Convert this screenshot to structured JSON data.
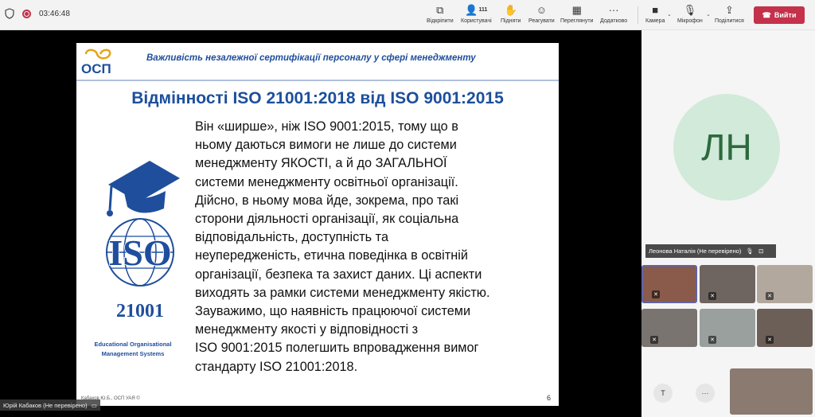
{
  "topbar": {
    "timer": "03:46:48",
    "participants_count": "111",
    "buttons": {
      "open": "Відкріпити",
      "users": "Користувачі",
      "raise": "Підняти",
      "react": "Реагувати",
      "view": "Переглянути",
      "more": "Додатково",
      "camera": "Камера",
      "mic": "Мікрофон",
      "share": "Поділитися"
    },
    "leave_label": "Вийти"
  },
  "slide": {
    "logo_text": "ОСП",
    "header": "Важливість незалежної сертифікації персоналу у сфері менеджменту",
    "title": "Відмінності ISO 21001:2018 від ISO 9001:2015",
    "body": "Він «ширше», ніж ISO 9001:2015, тому що в\nньому даються вимоги не лише до системи\nменеджменту ЯКОСТІ, а й до ЗАГАЛЬНОЇ\nсистеми менеджменту освітньої організації.\nДійсно, в ньому мова йде, зокрема, про такі\nсторони діяльності організації, як соціальна\nвідповідальність, доступність та\nнеупередженість, етична поведінка в освітній\nорганізації, безпека та захист даних. Ці аспекти\nвиходять за рамки системи менеджменту якістю.\nЗауважимо, що наявність працюючої системи\nменеджменту якості у відповідності з\nISO 9001:2015 полегшить впровадження вимог\nстандарту ISO 21001:2018.",
    "iso_text": "ISO",
    "iso_number": "21001",
    "iso_caption": "Educational Organisational Management Systems",
    "footer": "Кабаков Ю.Б., ОСП УАЯ ©",
    "page": "6"
  },
  "presenter": {
    "name": "Юрій Кабаков (Не перевірено)"
  },
  "sidebar": {
    "avatar_initials": "ЛН",
    "speaker_name": "Леонова Наталія (Не перевірено)",
    "overflow_initial": "T",
    "overflow_more": "···"
  },
  "colors": {
    "accent_blue": "#1f4e9c",
    "leave_red": "#c4314b",
    "avatar_bg": "#d2ead9"
  }
}
